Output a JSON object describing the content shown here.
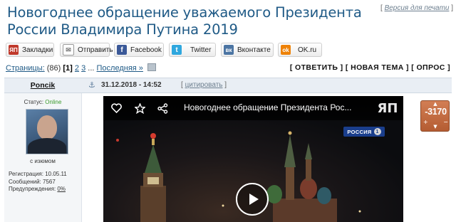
{
  "thread": {
    "title": "Новогоднее обращение уважаемого Президента России Владимира Путина 2019",
    "print_open": "[ ",
    "print_link": "Версия для печати",
    "print_close": " ]"
  },
  "share": [
    {
      "label": "Закладки",
      "icon": "ЯП",
      "color": "#c0392b"
    },
    {
      "label": "Отправить",
      "icon": "✉",
      "color": "#8a8a8a"
    },
    {
      "label": "Facebook",
      "icon": "f",
      "color": "#3b5998"
    },
    {
      "label": "Twitter",
      "icon": "t",
      "color": "#2fa7de"
    },
    {
      "label": "Вконтакте",
      "icon": "вк",
      "color": "#4c75a3"
    },
    {
      "label": "OK.ru",
      "icon": "ok",
      "color": "#ee8208"
    }
  ],
  "pagination": {
    "label": "Страницы:",
    "count": "(86)",
    "current": "[1]",
    "p2": "2",
    "p3": "3",
    "ellipsis": "...",
    "last": "Последняя »"
  },
  "actions": {
    "reply": "[ ОТВЕТИТЬ ]",
    "new_topic": "[ НОВАЯ ТЕМА ]",
    "poll": "[ ОПРОС ]"
  },
  "post": {
    "author": "Poncik",
    "anchor": "⚓",
    "date": "31.12.2018 - 14:52",
    "quote_open": "[ ",
    "quote_link": "цитировать",
    "quote_close": " ]"
  },
  "user": {
    "status_label": "Статус: ",
    "status_value": "Online",
    "caption": "с изюмом",
    "registration": "Регистрация: 10.05.11",
    "messages": "Сообщений: 7567",
    "warnings_label": "Предупреждения: ",
    "warnings_value": "0%"
  },
  "video": {
    "title": "Новогоднее обращение Президента Рос...",
    "channel": "РОССИЯ",
    "channel_num": "1",
    "logo": "ЯП"
  },
  "rating": {
    "value": "-3170",
    "plus": "+",
    "minus": "−",
    "up": "▲",
    "down": "▼"
  }
}
